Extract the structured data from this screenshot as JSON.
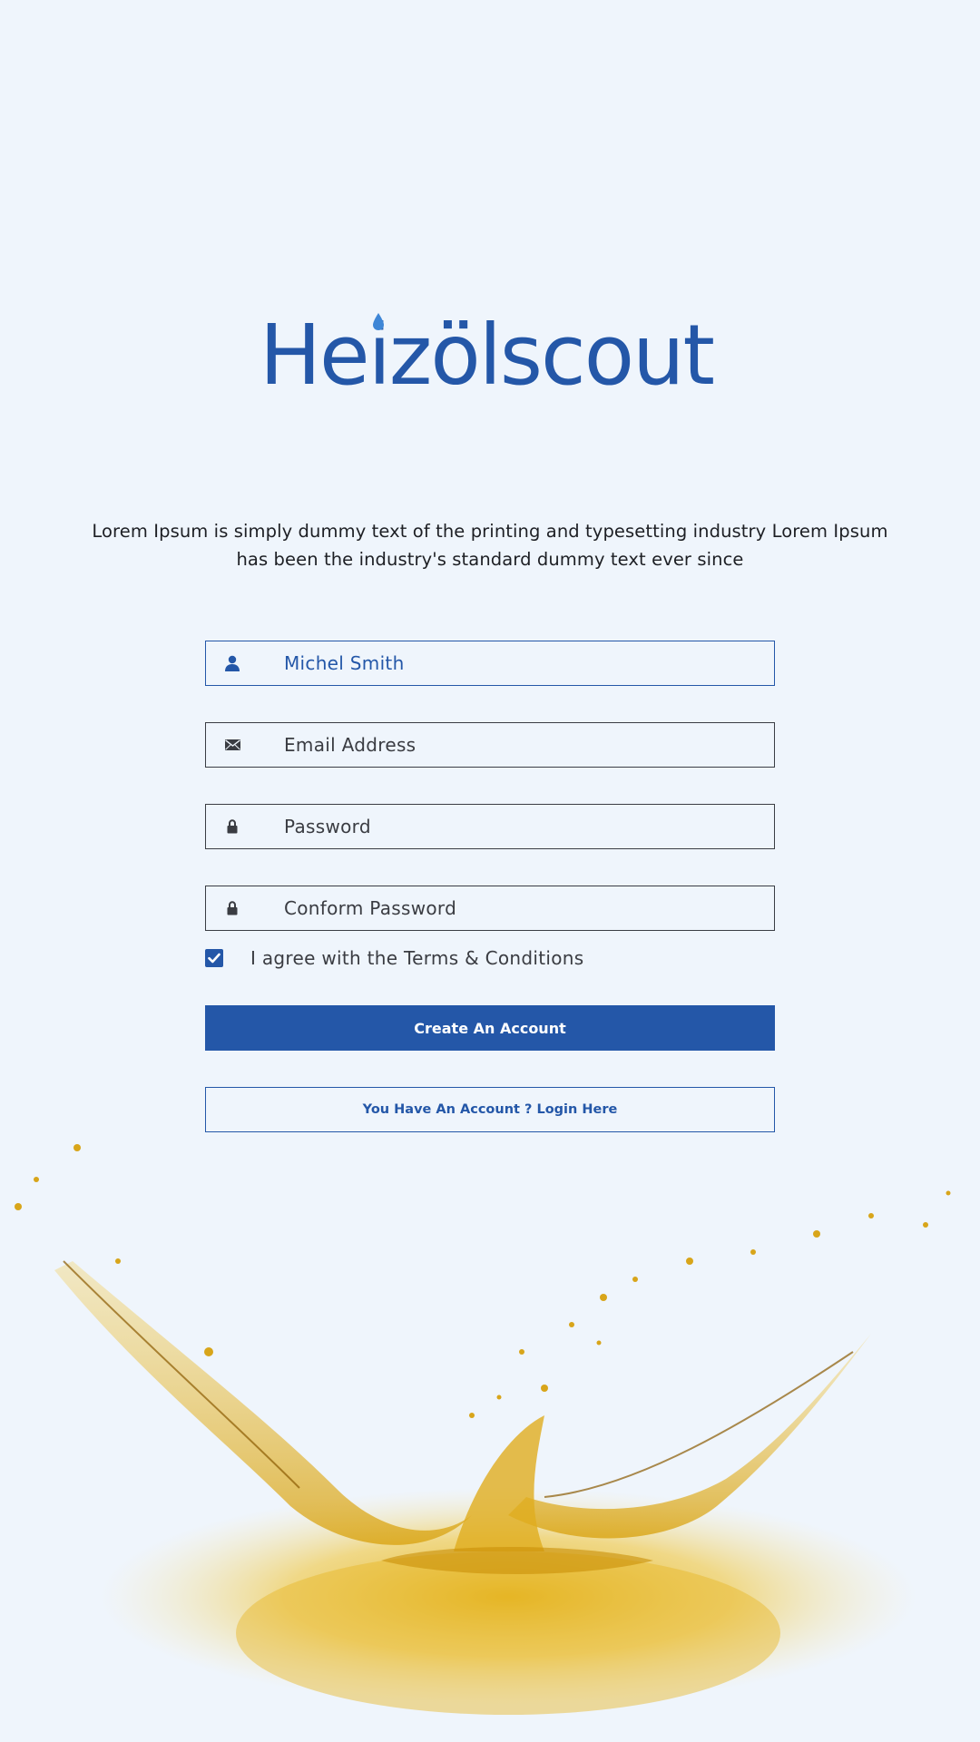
{
  "brand": {
    "logo_text": "Heizölscout",
    "primary_color": "#2457a8",
    "accent_color": "#3e86d6",
    "splash_color": "#e8b92a"
  },
  "intro": {
    "line1": "Lorem Ipsum is simply dummy text of the printing and typesetting industry Lorem Ipsum",
    "line2": "has been the industry's standard dummy text ever since"
  },
  "form": {
    "name": {
      "value": "Michel Smith",
      "icon": "user-icon"
    },
    "email": {
      "placeholder": "Email Address",
      "icon": "envelope-icon"
    },
    "password": {
      "placeholder": "Password",
      "icon": "lock-icon"
    },
    "confirm_password": {
      "placeholder": "Conform Password",
      "icon": "lock-icon"
    },
    "terms": {
      "checked": true,
      "label": "I agree with the Terms & Conditions"
    }
  },
  "actions": {
    "create_label": "Create An Account",
    "login_label": "You Have An Account ? Login Here"
  }
}
